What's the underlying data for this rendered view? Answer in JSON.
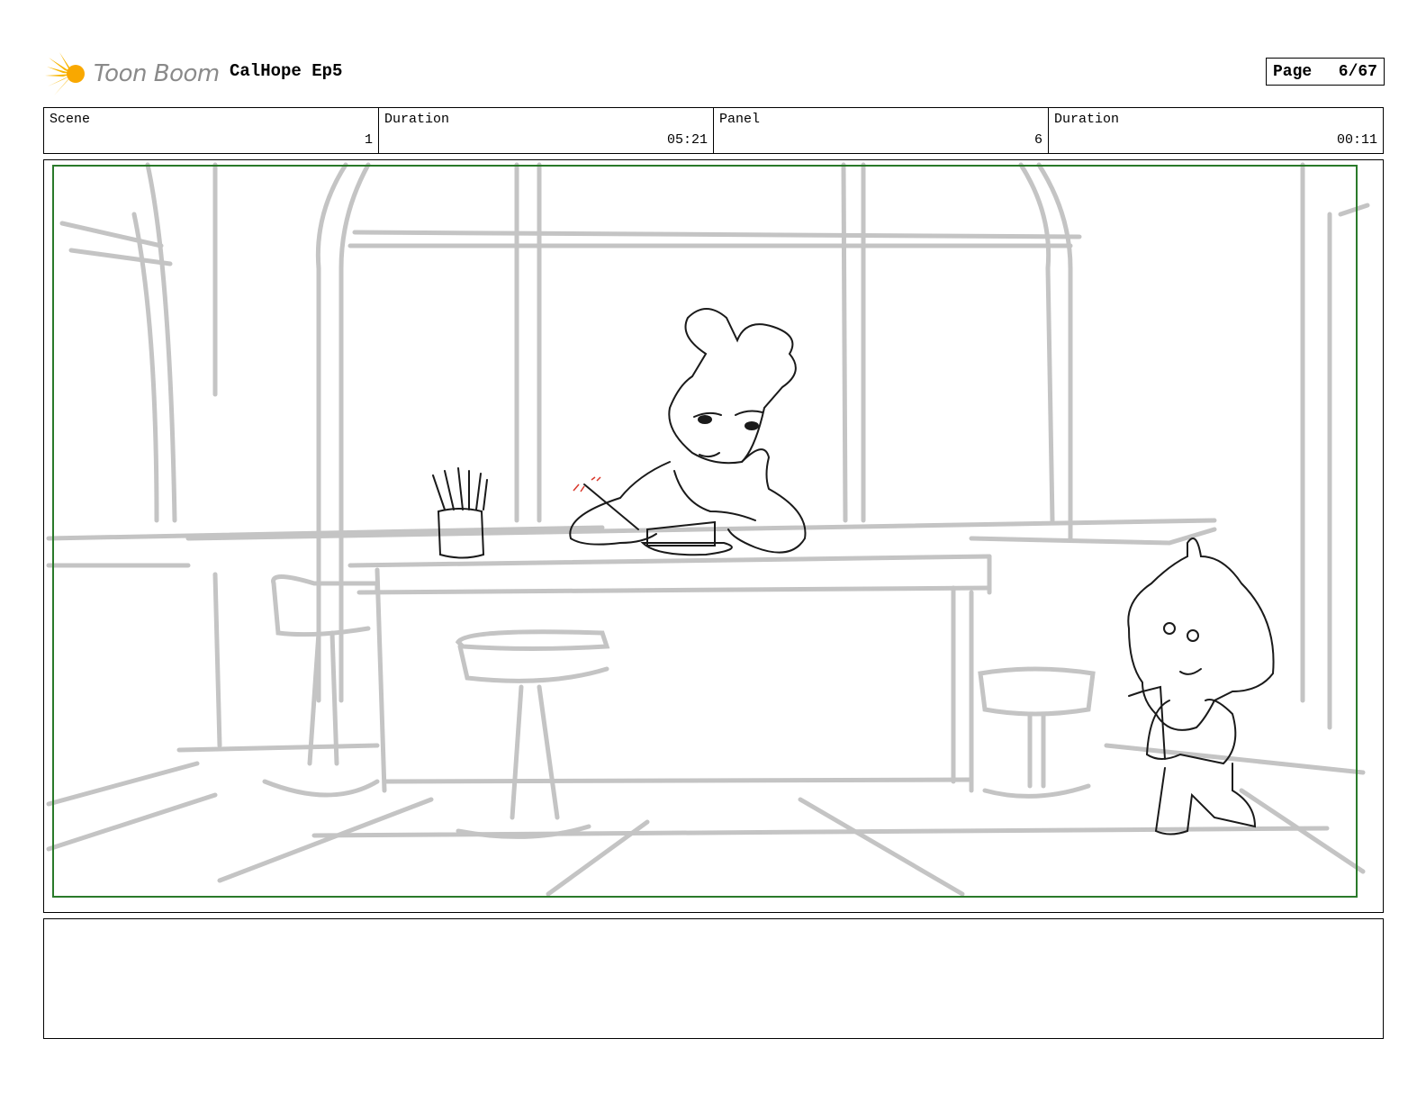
{
  "header": {
    "logo_text": "Toon Boom",
    "project_title": "CalHope Ep5",
    "page_label": "Page",
    "page_number": "6/67"
  },
  "info": {
    "scene_label": "Scene",
    "scene_value": "1",
    "scene_duration_label": "Duration",
    "scene_duration_value": "05:21",
    "panel_label": "Panel",
    "panel_value": "6",
    "panel_duration_label": "Duration",
    "panel_duration_value": "00:11"
  },
  "notes": {
    "text": ""
  },
  "colors": {
    "logo_ray": "#f7b500",
    "safe_frame": "#2a7a2a",
    "sketch_background": "#c4c4c4",
    "sketch_lines": "#1a1a1a"
  }
}
